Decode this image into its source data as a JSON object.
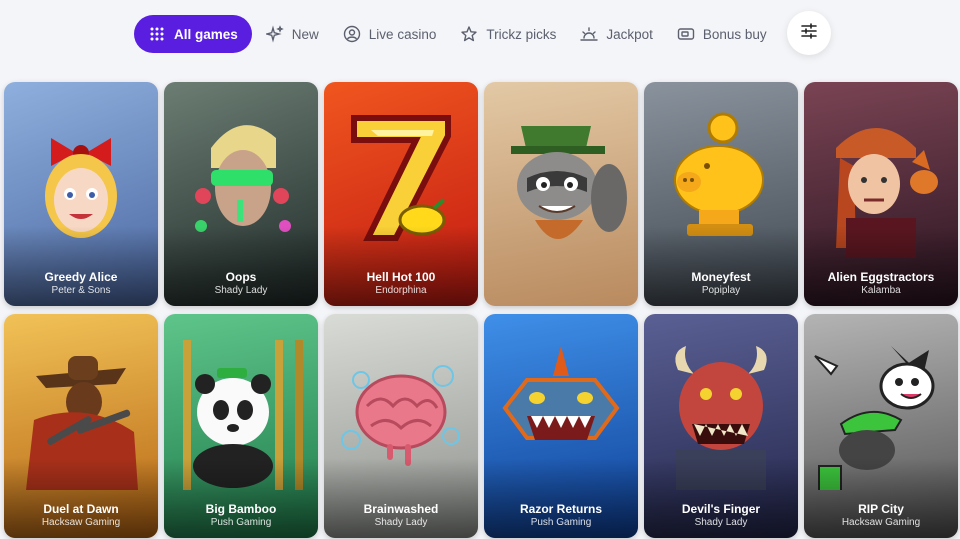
{
  "nav": {
    "tabs": [
      {
        "label": "All games",
        "icon": "grid-icon",
        "active": true
      },
      {
        "label": "New",
        "icon": "sparkle-icon",
        "active": false
      },
      {
        "label": "Live casino",
        "icon": "face-icon",
        "active": false
      },
      {
        "label": "Trickz picks",
        "icon": "star-icon",
        "active": false
      },
      {
        "label": "Jackpot",
        "icon": "sunrise-icon",
        "active": false
      },
      {
        "label": "Bonus buy",
        "icon": "ticket-icon",
        "active": false
      }
    ],
    "filter_icon": "sliders-icon",
    "accent": "#5a1ee0"
  },
  "games": [
    {
      "title": "Greedy Alice",
      "provider": "Peter & Sons",
      "bg": "#5d7fb8"
    },
    {
      "title": "Oops",
      "provider": "Shady Lady",
      "bg": "#3b4f4a"
    },
    {
      "title": "Hell Hot 100",
      "provider": "Endorphina",
      "bg": "#e0351b"
    },
    {
      "title": "",
      "provider": "",
      "bg": "#c9a27a"
    },
    {
      "title": "Moneyfest",
      "provider": "Popiplay",
      "bg": "#5b6470"
    },
    {
      "title": "Alien Eggstractors",
      "provider": "Kalamba",
      "bg": "#5b2a3a"
    },
    {
      "title": "Duel at Dawn",
      "provider": "Hacksaw Gaming",
      "bg": "#c9811d"
    },
    {
      "title": "Big Bamboo",
      "provider": "Push Gaming",
      "bg": "#2f9a62"
    },
    {
      "title": "Brainwashed",
      "provider": "Shady Lady",
      "bg": "#a8aaa6"
    },
    {
      "title": "Razor Returns",
      "provider": "Push Gaming",
      "bg": "#1b63c4"
    },
    {
      "title": "Devil's Finger",
      "provider": "Shady Lady",
      "bg": "#3a3f6d"
    },
    {
      "title": "RIP City",
      "provider": "Hacksaw Gaming",
      "bg": "#7a7a7a"
    }
  ]
}
